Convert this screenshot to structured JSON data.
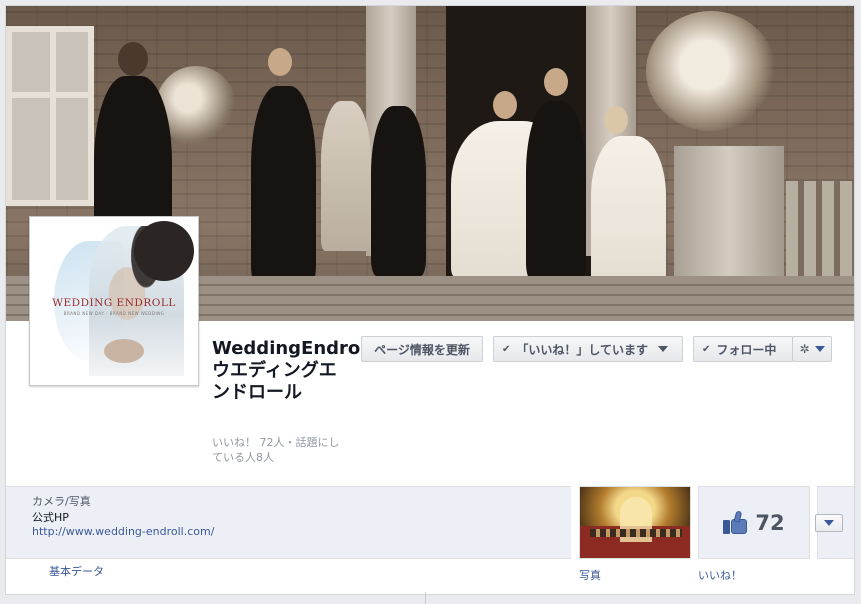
{
  "page": {
    "name": "WeddingEndroll ウエディングエンドロール",
    "stats": "いいね！ 72人・話題にしている人8人"
  },
  "profile_picture": {
    "logo_text": "WEDDING ENDROLL",
    "logo_subtext": "BRAND NEW DAY · BRAND NEW WEDDING"
  },
  "actions": {
    "update_info": "ページ情報を更新",
    "liked": "「いいね！」しています",
    "following": "フォロー中"
  },
  "about": {
    "category": "カメラ/写真",
    "homepage_label": "公式HP",
    "url": "http://www.wedding-endroll.com/",
    "section_label": "基本データ"
  },
  "apps": {
    "photos_label": "写真",
    "likes_label": "いいね！",
    "likes_count": "72"
  },
  "colors": {
    "link": "#3b5998",
    "accent": "#5b7bb9",
    "text": "#141823",
    "muted": "#9197a3"
  },
  "icons": [
    "check-icon",
    "caret-down-icon",
    "gear-icon",
    "thumbs-up-icon"
  ]
}
